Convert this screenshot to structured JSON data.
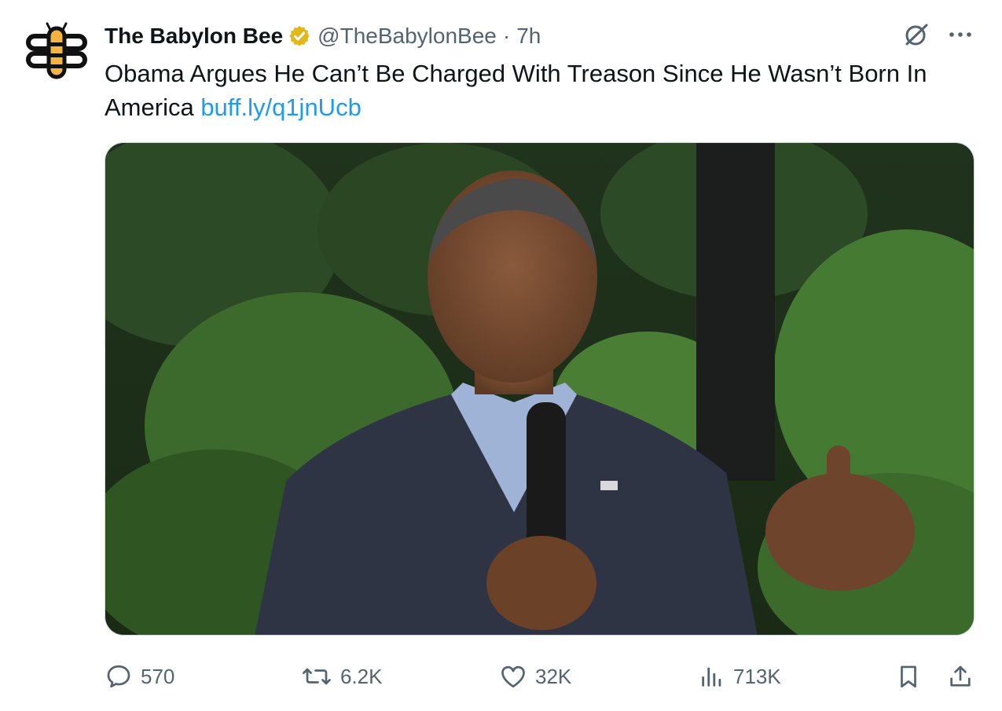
{
  "tweet": {
    "author": {
      "display_name": "The Babylon Bee",
      "handle": "@TheBabylonBee",
      "separator": "·",
      "time": "7h",
      "avatar_icon": "bee-logo",
      "verified_icon": "gold-verified-badge"
    },
    "text": "Obama Argues He Can’t Be Charged With Treason Since He Wasn’t Born In America ",
    "link": "buff.ly/q1jnUcb",
    "header_icons": [
      "grok-icon",
      "more-icon"
    ]
  },
  "actions": {
    "reply_count": "570",
    "retweet_count": "6.2K",
    "like_count": "32K",
    "views_count": "713K"
  },
  "colors": {
    "text": "#0f1419",
    "muted": "#536471",
    "link": "#1d9bf0",
    "verified_gold": "#e2b719",
    "bee_yellow": "#f5b342"
  }
}
